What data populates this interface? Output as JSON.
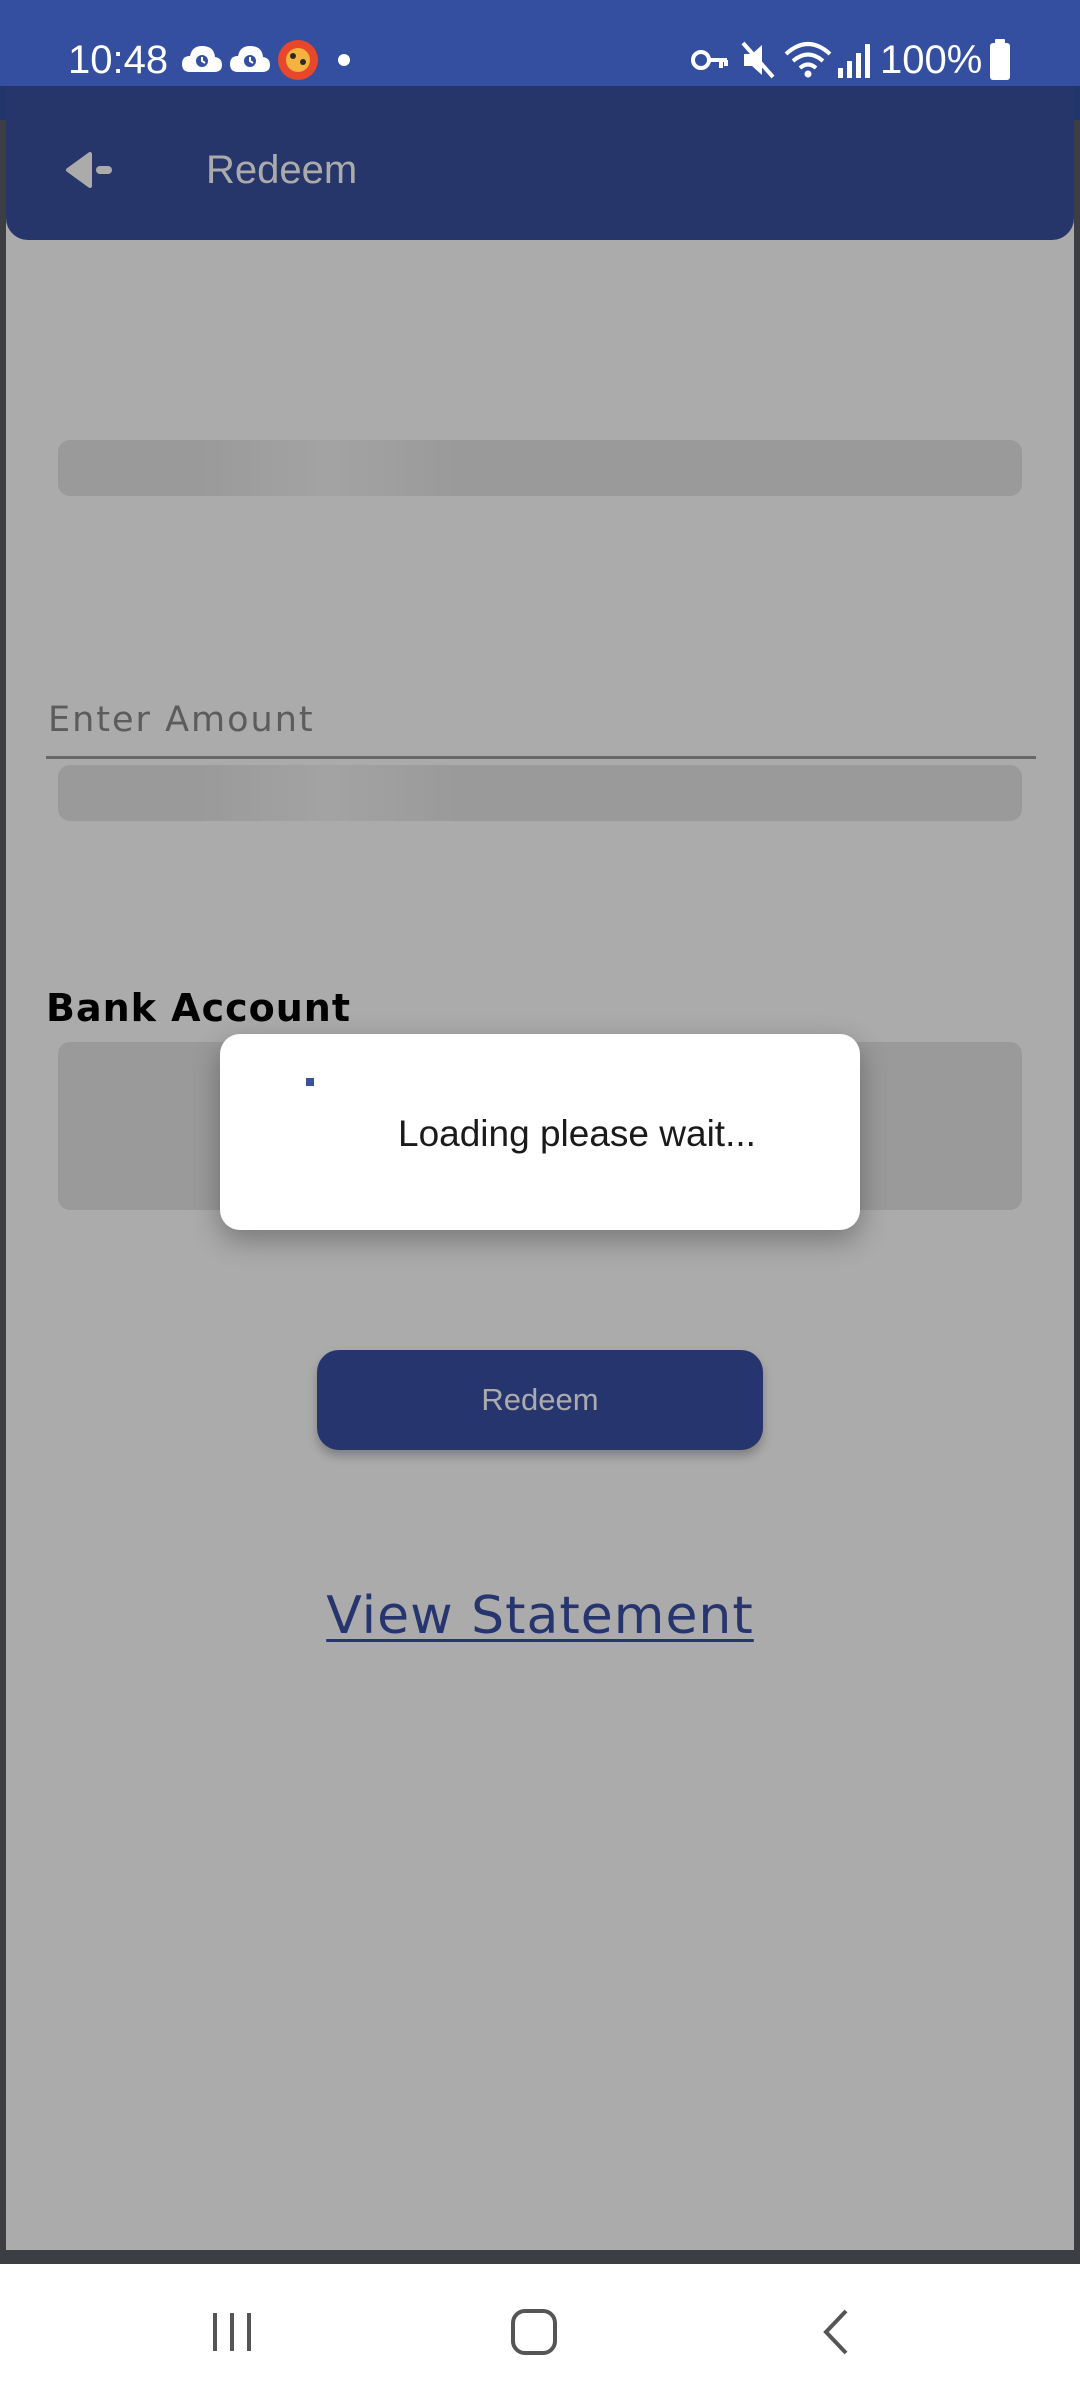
{
  "status_bar": {
    "time": "10:48",
    "battery_percent": "100%",
    "icons": [
      "cloud-icon",
      "cloud-icon",
      "app-notification-icon",
      "dot-icon",
      "vpn-key-icon",
      "mute-icon",
      "wifi-icon",
      "signal-icon",
      "battery-icon"
    ]
  },
  "app_bar": {
    "title": "Redeem",
    "back_icon": "back-arrow-icon",
    "color": "#3a519f"
  },
  "form": {
    "amount_placeholder": "Enter Amount",
    "amount_value": "",
    "bank_account_heading": "Bank Account",
    "redeem_label": "Redeem",
    "view_statement_label": "View Statement"
  },
  "dialog": {
    "message": "Loading please wait..."
  },
  "nav_bar": {
    "icons": [
      "recents-icon",
      "home-icon",
      "back-icon"
    ]
  },
  "colors": {
    "primary": "#3a519f",
    "skeleton": "#e6e6e6"
  }
}
